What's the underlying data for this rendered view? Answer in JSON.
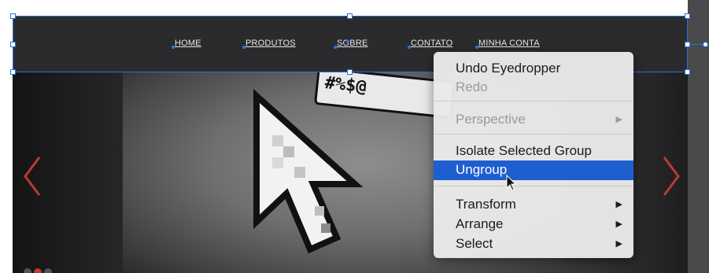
{
  "navbar": {
    "items": [
      {
        "label": "HOME"
      },
      {
        "label": "PRODUTOS"
      },
      {
        "label": "SOBRE"
      },
      {
        "label": "CONTATO"
      },
      {
        "label": "MINHA CONTA"
      }
    ]
  },
  "hero": {
    "badge_text": "#%$@",
    "arrow_color": "#c0392b"
  },
  "context_menu": {
    "undo": "Undo Eyedropper",
    "redo": "Redo",
    "perspective": "Perspective",
    "isolate": "Isolate Selected Group",
    "ungroup": "Ungroup",
    "transform": "Transform",
    "arrange": "Arrange",
    "select": "Select",
    "submenu_glyph": "▶"
  },
  "colors": {
    "selection": "#2e6fd8",
    "highlight": "#1e5fd0",
    "navbar_bg": "#2b2b2d"
  }
}
